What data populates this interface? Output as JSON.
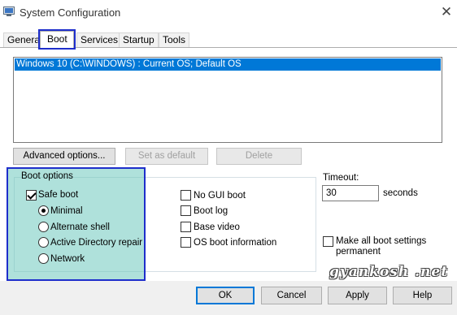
{
  "window": {
    "title": "System Configuration"
  },
  "tabs": [
    {
      "label": "General"
    },
    {
      "label": "Boot"
    },
    {
      "label": "Services"
    },
    {
      "label": "Startup"
    },
    {
      "label": "Tools"
    }
  ],
  "active_tab": "Boot",
  "os_list": {
    "items": [
      "Windows 10 (C:\\WINDOWS) : Current OS; Default OS"
    ]
  },
  "os_buttons": {
    "advanced": "Advanced options...",
    "set_default": "Set as default",
    "delete": "Delete"
  },
  "boot_options": {
    "legend": "Boot options",
    "safe_boot": {
      "label": "Safe boot",
      "checked": true
    },
    "radios": [
      {
        "label": "Minimal",
        "selected": true
      },
      {
        "label": "Alternate shell",
        "selected": false
      },
      {
        "label": "Active Directory repair",
        "selected": false
      },
      {
        "label": "Network",
        "selected": false
      }
    ],
    "checkboxes": [
      {
        "label": "No GUI boot",
        "checked": false
      },
      {
        "label": "Boot log",
        "checked": false
      },
      {
        "label": "Base video",
        "checked": false
      },
      {
        "label": "OS boot information",
        "checked": false
      }
    ]
  },
  "timeout": {
    "label": "Timeout:",
    "value": "30",
    "unit": "seconds"
  },
  "make_permanent": {
    "label_line1": "Make all boot settings",
    "label_line2": "permanent",
    "checked": false
  },
  "footer": {
    "ok": "OK",
    "cancel": "Cancel",
    "apply": "Apply",
    "help": "Help"
  },
  "watermark": "gyankosh .net",
  "colors": {
    "selection": "#0078d7",
    "highlight_box": "#6ec8be",
    "annotation_border": "#1e2ecb"
  }
}
